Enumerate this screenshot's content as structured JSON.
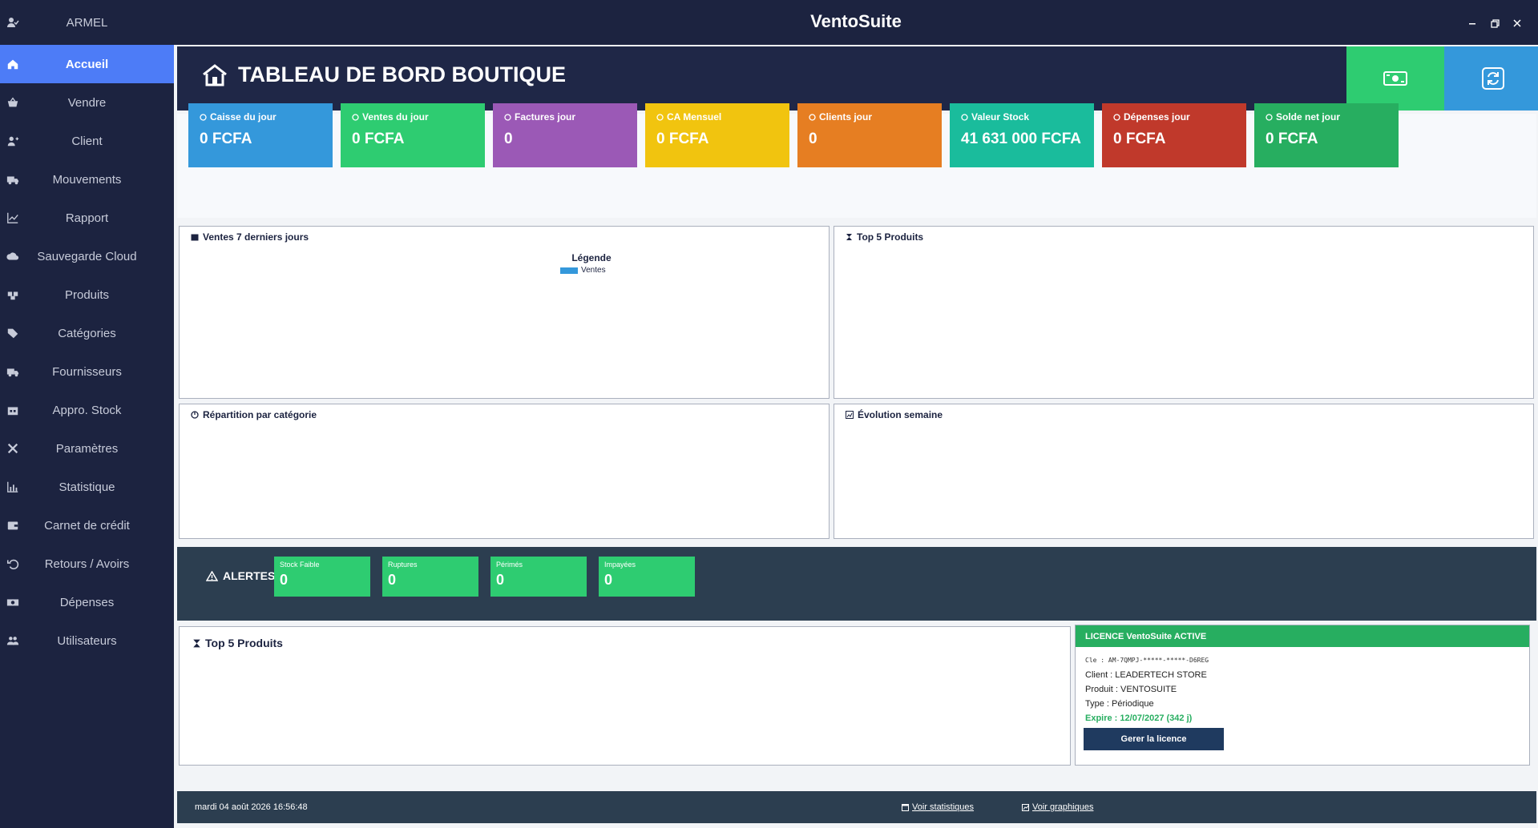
{
  "app_title": "VentoSuite",
  "user": "ARMEL",
  "nav": [
    {
      "label": "Accueil",
      "icon": "home-icon",
      "active": true
    },
    {
      "label": "Vendre",
      "icon": "basket-icon"
    },
    {
      "label": "Client",
      "icon": "user-plus-icon"
    },
    {
      "label": "Mouvements",
      "icon": "truck-icon"
    },
    {
      "label": "Rapport",
      "icon": "line-chart-icon"
    },
    {
      "label": "Sauvegarde Cloud",
      "icon": "cloud-upload-icon"
    },
    {
      "label": "Produits",
      "icon": "boxes-icon"
    },
    {
      "label": "Catégories",
      "icon": "tags-icon"
    },
    {
      "label": "Fournisseurs",
      "icon": "truck-icon"
    },
    {
      "label": "Appro. Stock",
      "icon": "warehouse-icon"
    },
    {
      "label": "Paramètres",
      "icon": "tools-icon"
    },
    {
      "label": "Statistique",
      "icon": "bar-chart-icon"
    },
    {
      "label": "Carnet de crédit",
      "icon": "wallet-icon"
    },
    {
      "label": "Retours / Avoirs",
      "icon": "undo-icon"
    },
    {
      "label": "Dépenses",
      "icon": "money-icon"
    },
    {
      "label": "Utilisateurs",
      "icon": "users-icon"
    }
  ],
  "header": {
    "title": "TABLEAU DE BORD BOUTIQUE"
  },
  "kpis": [
    {
      "label": "Caisse du jour",
      "value": "0 FCFA",
      "color": "#3498db"
    },
    {
      "label": "Ventes du jour",
      "value": "0 FCFA",
      "color": "#2ecc71"
    },
    {
      "label": "Factures jour",
      "value": "0",
      "color": "#9b59b6"
    },
    {
      "label": "CA Mensuel",
      "value": "0 FCFA",
      "color": "#f1c40f"
    },
    {
      "label": "Clients jour",
      "value": "0",
      "color": "#e67e22"
    },
    {
      "label": "Valeur Stock",
      "value": "41 631 000 FCFA",
      "color": "#1abc9c"
    },
    {
      "label": "Dépenses jour",
      "value": "0 FCFA",
      "color": "#c0392b"
    },
    {
      "label": "Solde net jour",
      "value": "0 FCFA",
      "color": "#27ae60"
    }
  ],
  "panels": {
    "sales7": "Ventes 7 derniers jours",
    "top5": "Top 5 Produits",
    "categories": "Répartition par catégorie",
    "evolution": "Évolution semaine",
    "top5_bottom": "Top 5 Produits"
  },
  "chart_data": {
    "type": "bar",
    "title": "",
    "legend_title": "Légende",
    "series": [
      {
        "name": "Ventes",
        "values": []
      }
    ],
    "legend_color": "#3498db"
  },
  "alerts": {
    "title": "ALERTES",
    "items": [
      {
        "label": "Stock Faible",
        "value": "0"
      },
      {
        "label": "Ruptures",
        "value": "0"
      },
      {
        "label": "Périmés",
        "value": "0"
      },
      {
        "label": "Impayées",
        "value": "0"
      }
    ]
  },
  "license": {
    "header": "LICENCE VentoSuite  ACTIVE",
    "key": "Cle : AM-7QMPJ-*****-*****-D6REG",
    "client": "Client : LEADERTECH STORE",
    "product": "Produit : VENTOSUITE",
    "type": "Type : Périodique",
    "expire": "Expire : 12/07/2027  (342 j)",
    "button": "Gerer la licence"
  },
  "footer": {
    "datetime": "mardi 04 août 2026 16:56:48",
    "link_stats": "Voir statistiques",
    "link_graphs": "Voir graphiques"
  }
}
